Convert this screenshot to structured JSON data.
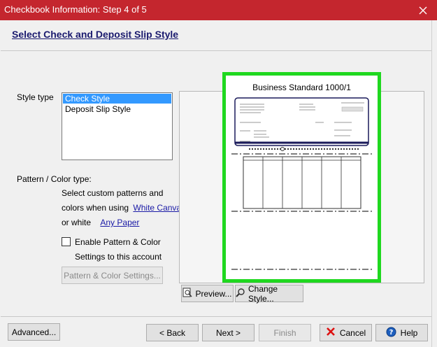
{
  "window": {
    "title": "Checkbook Information: Step 4 of 5"
  },
  "header": {
    "title": "Select Check and Deposit Slip Style"
  },
  "style_type": {
    "label": "Style type",
    "options": [
      "Check Style",
      "Deposit Slip Style"
    ],
    "selected": "Check Style"
  },
  "pattern": {
    "label": "Pattern / Color type:",
    "line1": "Select custom patterns and",
    "line2_prefix": "colors when using",
    "white_canvas_link": "White Canvas",
    "line3_prefix": "or white",
    "any_paper_link": "Any Paper",
    "enable_label_1": "Enable Pattern & Color",
    "enable_label_2": "Settings to this account",
    "enable_checked": false,
    "settings_button": "Pattern & Color Settings..."
  },
  "preview": {
    "style_name": "Business Standard 1000/1",
    "preview_button": "Preview...",
    "change_style_button": "Change Style..."
  },
  "footer": {
    "advanced": "Advanced...",
    "back": "< Back",
    "next": "Next >",
    "finish": "Finish",
    "cancel": "Cancel",
    "help": "Help"
  },
  "colors": {
    "titlebar": "#c4262e",
    "highlight": "#1fd81f",
    "selection": "#3399ff"
  }
}
